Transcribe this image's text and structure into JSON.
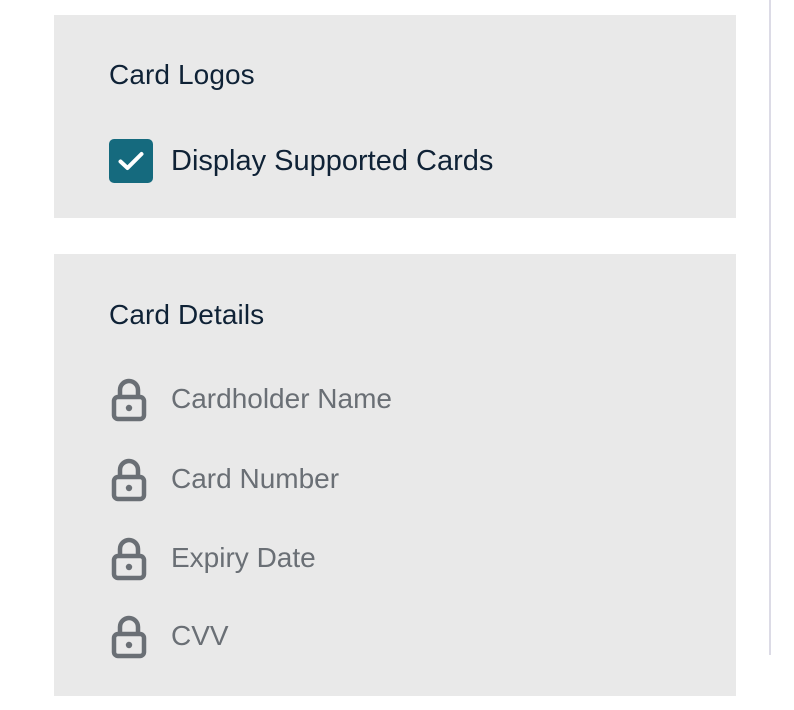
{
  "card_logos": {
    "title": "Card Logos",
    "display_supported_cards": {
      "label": "Display Supported Cards",
      "checked": true
    }
  },
  "card_details": {
    "title": "Card Details",
    "fields": [
      {
        "label": "Cardholder Name",
        "icon": "lock-icon"
      },
      {
        "label": "Card Number",
        "icon": "lock-icon"
      },
      {
        "label": "Expiry Date",
        "icon": "lock-icon"
      },
      {
        "label": "CVV",
        "icon": "lock-icon"
      }
    ]
  },
  "colors": {
    "panel_background": "#e9e9e9",
    "checkbox_accent": "#156a7e",
    "heading_text": "#0f2236",
    "locked_field_text": "#6a6f75"
  }
}
